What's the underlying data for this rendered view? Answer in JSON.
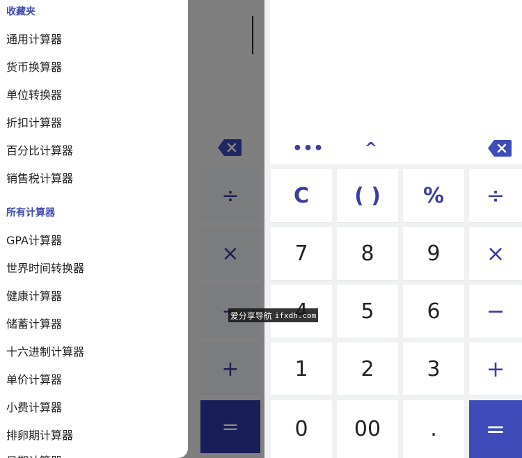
{
  "drawer": {
    "favorites_title": "收藏夹",
    "favorites": [
      "通用计算器",
      "货币换算器",
      "单位转换器",
      "折扣计算器",
      "百分比计算器",
      "销售税计算器"
    ],
    "all_title": "所有计算器",
    "all": [
      "GPA计算器",
      "世界时间转换器",
      "健康计算器",
      "储蓄计算器",
      "十六进制计算器",
      "单价计算器",
      "小费计算器",
      "排卵期计算器",
      "日期计算器"
    ]
  },
  "toolbar": {
    "more": "•••",
    "caret": "^"
  },
  "keys": {
    "clear": "C",
    "parens": "( )",
    "percent": "%",
    "divide": "÷",
    "seven": "7",
    "eight": "8",
    "nine": "9",
    "multiply": "×",
    "four": "4",
    "five": "5",
    "six": "6",
    "minus": "−",
    "one": "1",
    "two": "2",
    "three": "3",
    "plus": "+",
    "zero": "0",
    "double_zero": "00",
    "dot": ".",
    "equals": "="
  },
  "bg_keys": {
    "divide": "÷",
    "multiply": "×",
    "minus": "−",
    "plus": "+",
    "equals": "="
  },
  "watermark": {
    "label": "爱分享导航",
    "domain": "ifxdh.com"
  },
  "colors": {
    "accent": "#3f4bb8",
    "accent_text": "#3b3f9e",
    "section_title": "#3f4bb0"
  }
}
